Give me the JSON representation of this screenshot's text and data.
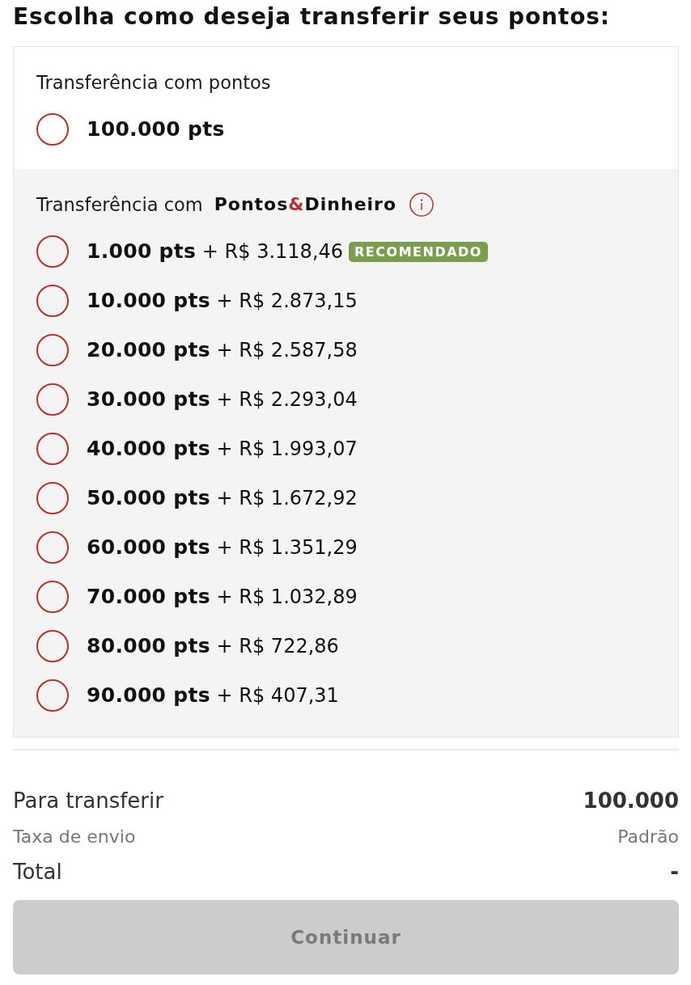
{
  "title": "Escolha como deseja transferir seus pontos:",
  "options_card": {
    "sections": [
      {
        "kind": "points",
        "label": "Transferência com pontos",
        "options": [
          {
            "points": "100.000 pts",
            "selected": false
          }
        ]
      },
      {
        "kind": "points_money",
        "label": "Transferência com",
        "brand": {
          "first": "Pontos",
          "ampersand": "&",
          "second": "Dinheiro"
        },
        "info": true,
        "options": [
          {
            "points": "1.000 pts",
            "price": "+ R$ 3.118,46",
            "badge": "RECOMENDADO",
            "selected": false
          },
          {
            "points": "10.000 pts",
            "price": "+ R$ 2.873,15",
            "selected": false
          },
          {
            "points": "20.000 pts",
            "price": "+ R$ 2.587,58",
            "selected": false
          },
          {
            "points": "30.000 pts",
            "price": "+ R$ 2.293,04",
            "selected": false
          },
          {
            "points": "40.000 pts",
            "price": "+ R$ 1.993,07",
            "selected": false
          },
          {
            "points": "50.000 pts",
            "price": "+ R$ 1.672,92",
            "selected": false
          },
          {
            "points": "60.000 pts",
            "price": "+ R$ 1.351,29",
            "selected": false
          },
          {
            "points": "70.000 pts",
            "price": "+ R$ 1.032,89",
            "selected": false
          },
          {
            "points": "80.000 pts",
            "price": "+ R$ 722,86",
            "selected": false
          },
          {
            "points": "90.000 pts",
            "price": "+ R$ 407,31",
            "selected": false
          }
        ]
      }
    ]
  },
  "summary": [
    {
      "kind": "primary",
      "label": "Para transferir",
      "value": "100.000"
    },
    {
      "kind": "secondary",
      "label": "Taxa de envio",
      "value": "Padrão"
    },
    {
      "kind": "total",
      "label": "Total",
      "value": "-"
    }
  ],
  "continue_button": {
    "label": "Continuar",
    "disabled": true
  }
}
